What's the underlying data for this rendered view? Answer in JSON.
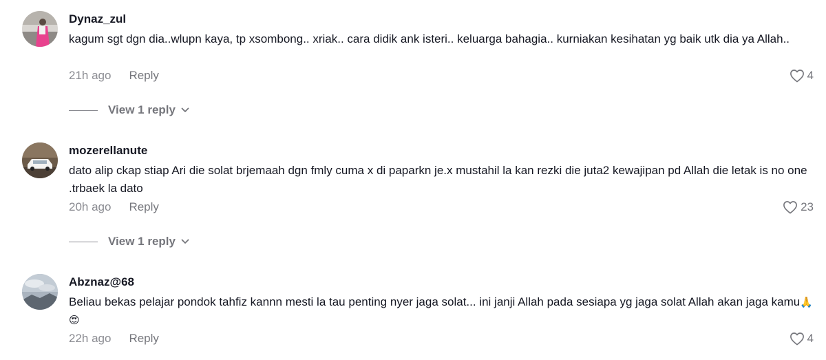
{
  "comments": [
    {
      "username": "Dynaz_zul",
      "text": "kagum sgt dgn dia..wlupn kaya, tp xsombong.. xriak.. cara didik ank isteri.. keluarga bahagia.. kurniakan kesihatan yg baik utk dia ya Allah..",
      "time": "21h ago",
      "reply_label": "Reply",
      "likes": "4",
      "view_replies": "View 1 reply",
      "avatar_icon": "user-avatar-pink-outfit"
    },
    {
      "username": "mozerellanute",
      "text": "dato alip ckap stiap Ari die solat brjemaah dgn fmly cuma x di paparkn je.x mustahil la kan rezki die juta2 kewajipan pd Allah die letak is no one .trbaek la dato",
      "time": "20h ago",
      "reply_label": "Reply",
      "likes": "23",
      "view_replies": "View 1 reply",
      "avatar_icon": "user-avatar-white-car"
    },
    {
      "username": "Abznaz@68",
      "text": "Beliau bekas pelajar pondok tahfiz kannn mesti la tau penting nyer jaga solat... ini janji Allah pada sesiapa yg jaga solat Allah akan jaga kamu",
      "emojis": "🙏😍",
      "time": "22h ago",
      "reply_label": "Reply",
      "likes": "4",
      "avatar_icon": "user-avatar-sky-landscape"
    }
  ],
  "colors": {
    "primary_text": "#161823",
    "secondary_text": "#8a8b91",
    "icon": "#75767c"
  }
}
